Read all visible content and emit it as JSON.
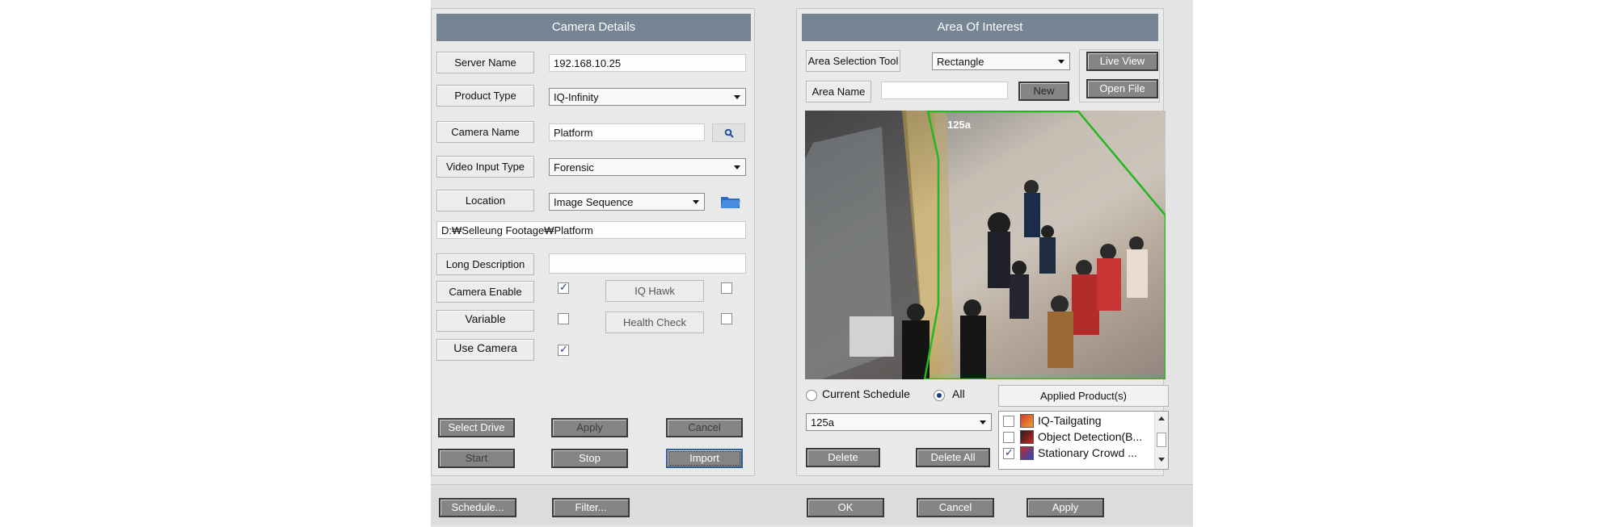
{
  "camera_details": {
    "title": "Camera Details",
    "server_name_label": "Server Name",
    "server_name_value": "192.168.10.25",
    "product_type_label": "Product Type",
    "product_type_value": "IQ-Infinity",
    "camera_name_label": "Camera Name",
    "camera_name_value": "Platform",
    "video_input_type_label": "Video Input Type",
    "video_input_type_value": "Forensic",
    "location_label": "Location",
    "location_value": "Image Sequence",
    "path_value": "D:₩Selleung Footage₩Platform",
    "long_description_label": "Long Description",
    "long_description_value": "",
    "camera_enable_label": "Camera Enable",
    "camera_enable_checked": true,
    "iq_hawk_label": "IQ Hawk",
    "iq_hawk_checked": false,
    "variable_label": "Variable",
    "variable_checked": false,
    "health_check_label": "Health Check",
    "health_check_checked": false,
    "use_camera_label": "Use Camera",
    "use_camera_checked": true,
    "buttons": {
      "select_drive": "Select Drive",
      "apply": "Apply",
      "cancel": "Cancel",
      "start": "Start",
      "stop": "Stop",
      "import": "Import"
    }
  },
  "area_of_interest": {
    "title": "Area Of Interest",
    "area_selection_tool_label": "Area Selection Tool",
    "area_selection_tool_value": "Rectangle",
    "area_name_label": "Area Name",
    "area_name_value": "",
    "new_button": "New",
    "live_view_button": "Live View",
    "open_file_button": "Open File",
    "area_tag": "125a",
    "current_schedule_label": "Current Schedule",
    "all_label": "All",
    "schedule_selected": "All",
    "area_dropdown_value": "125a",
    "delete_button": "Delete",
    "delete_all_button": "Delete All",
    "applied_products_header": "Applied Product(s)",
    "applied_products": [
      {
        "label": "IQ-Tailgating",
        "checked": false
      },
      {
        "label": "Object Detection(B...",
        "checked": false
      },
      {
        "label": "Stationary Crowd ...",
        "checked": true
      }
    ]
  },
  "footer": {
    "schedule_button": "Schedule...",
    "filter_button": "Filter...",
    "ok_button": "OK",
    "cancel_button": "Cancel",
    "apply_button": "Apply"
  },
  "colors": {
    "header_bg": "#768494",
    "button_bg": "#858585",
    "roi_polygon": "#22b81e",
    "dialog_bg": "#e4e4e4"
  }
}
